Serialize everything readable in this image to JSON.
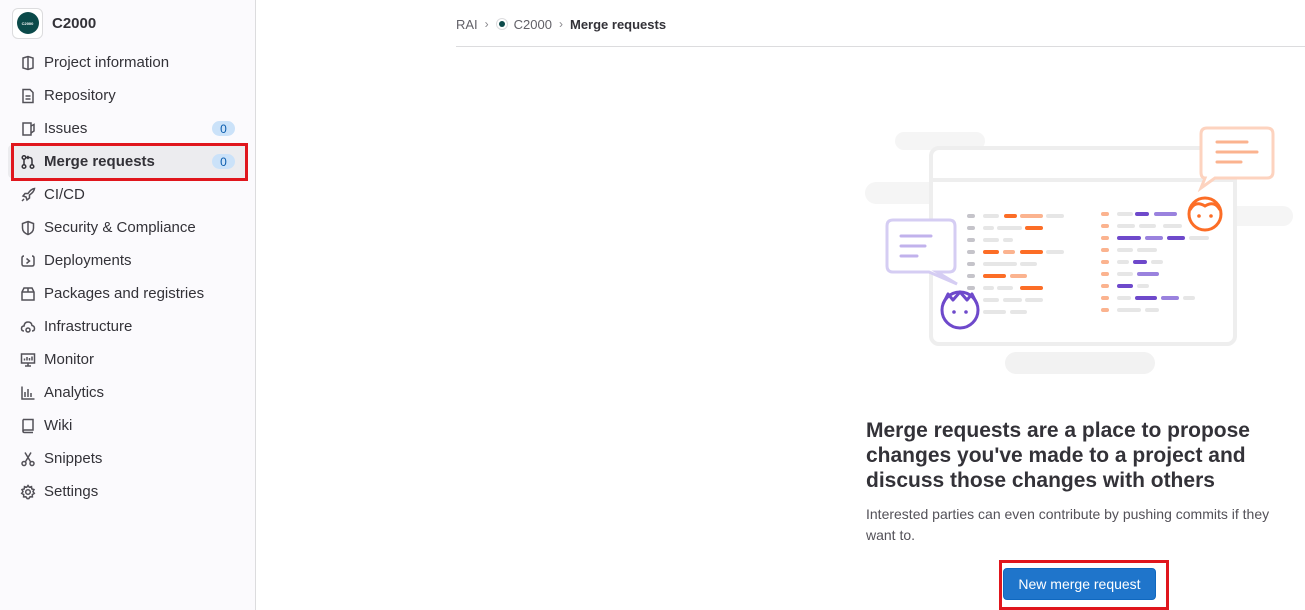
{
  "project": {
    "name": "C2000",
    "avatar_text": "C2000"
  },
  "sidebar": {
    "items": [
      {
        "label": "Project information",
        "icon": "project-icon"
      },
      {
        "label": "Repository",
        "icon": "document-icon"
      },
      {
        "label": "Issues",
        "icon": "issues-icon",
        "badge": "0"
      },
      {
        "label": "Merge requests",
        "icon": "git-merge-icon",
        "badge": "0",
        "active": true
      },
      {
        "label": "CI/CD",
        "icon": "rocket-icon"
      },
      {
        "label": "Security & Compliance",
        "icon": "shield-icon"
      },
      {
        "label": "Deployments",
        "icon": "deployments-icon"
      },
      {
        "label": "Packages and registries",
        "icon": "package-icon"
      },
      {
        "label": "Infrastructure",
        "icon": "cloud-gear-icon"
      },
      {
        "label": "Monitor",
        "icon": "monitor-icon"
      },
      {
        "label": "Analytics",
        "icon": "chart-icon"
      },
      {
        "label": "Wiki",
        "icon": "book-icon"
      },
      {
        "label": "Snippets",
        "icon": "scissors-icon"
      },
      {
        "label": "Settings",
        "icon": "gear-icon"
      }
    ]
  },
  "breadcrumb": {
    "group": "RAI",
    "project": "C2000",
    "current": "Merge requests"
  },
  "empty_state": {
    "title": "Merge requests are a place to propose changes you've made to a project and discuss those changes with others",
    "description": "Interested parties can even contribute by pushing commits if they want to.",
    "button_label": "New merge request"
  },
  "colors": {
    "primary": "#1f75cb",
    "highlight": "#e0161d",
    "sidebar_bg": "#fbfafd"
  }
}
